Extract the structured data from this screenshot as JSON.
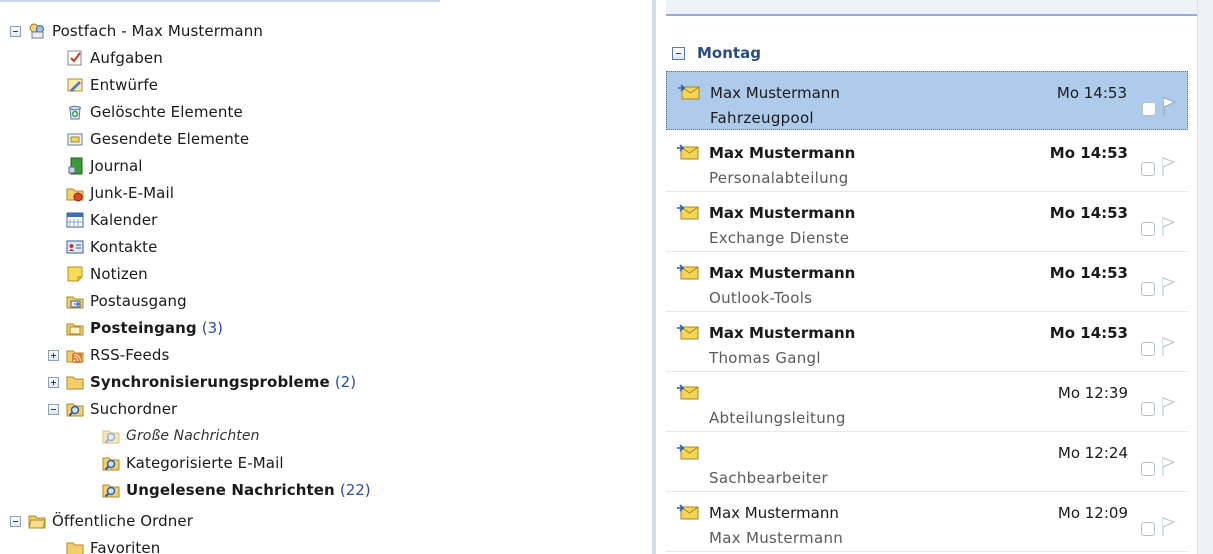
{
  "tree": {
    "mailbox": {
      "label": "Postfach - Max Mustermann"
    },
    "items": [
      {
        "label": "Aufgaben"
      },
      {
        "label": "Entwürfe"
      },
      {
        "label": "Gelöschte Elemente"
      },
      {
        "label": "Gesendete Elemente"
      },
      {
        "label": "Journal"
      },
      {
        "label": "Junk-E-Mail"
      },
      {
        "label": "Kalender"
      },
      {
        "label": "Kontakte"
      },
      {
        "label": "Notizen"
      },
      {
        "label": "Postausgang"
      },
      {
        "label": "Posteingang",
        "count": "(3)"
      },
      {
        "label": "RSS-Feeds"
      },
      {
        "label": "Synchronisierungsprobleme",
        "count": "(2)"
      },
      {
        "label": "Suchordner"
      },
      {
        "label": "Große Nachrichten"
      },
      {
        "label": "Kategorisierte E-Mail"
      },
      {
        "label": "Ungelesene Nachrichten",
        "count": "(22)"
      },
      {
        "label": "Öffentliche Ordner"
      },
      {
        "label": "Favoriten"
      }
    ]
  },
  "messages": {
    "group": "Montag",
    "rows": [
      {
        "from": "Max Mustermann",
        "subject": "Fahrzeugpool",
        "time": "Mo 14:53"
      },
      {
        "from": "Max Mustermann",
        "subject": "Personalabteilung",
        "time": "Mo 14:53"
      },
      {
        "from": "Max Mustermann",
        "subject": "Exchange Dienste",
        "time": "Mo 14:53"
      },
      {
        "from": "Max Mustermann",
        "subject": "Outlook-Tools",
        "time": "Mo 14:53"
      },
      {
        "from": "Max Mustermann",
        "subject": "Thomas Gangl",
        "time": "Mo 14:53"
      },
      {
        "from": "",
        "subject": "Abteilungsleitung",
        "time": "Mo 12:39"
      },
      {
        "from": "",
        "subject": "Sachbearbeiter",
        "time": "Mo 12:24"
      },
      {
        "from": "Max Mustermann",
        "subject": "Max Mustermann",
        "time": "Mo 12:09"
      }
    ]
  },
  "icons": {
    "mailbox": "mailbox-icon",
    "tasks": "tasks-icon",
    "drafts": "drafts-icon",
    "deleted": "deleted-items-icon",
    "sent": "sent-items-icon",
    "journal": "journal-icon",
    "junk": "junk-mail-icon",
    "calendar": "calendar-icon",
    "contacts": "contacts-icon",
    "notes": "notes-icon",
    "outbox": "outbox-icon",
    "inbox": "inbox-icon",
    "rss": "rss-icon",
    "folder": "folder-icon",
    "search_folder": "search-folder-icon",
    "public": "public-folders-icon",
    "message": "envelope-icon",
    "flag": "flag-icon"
  },
  "colors": {
    "selection": "#aecbeb",
    "group_label": "#2b4c7e",
    "count": "#2c4ea8"
  }
}
